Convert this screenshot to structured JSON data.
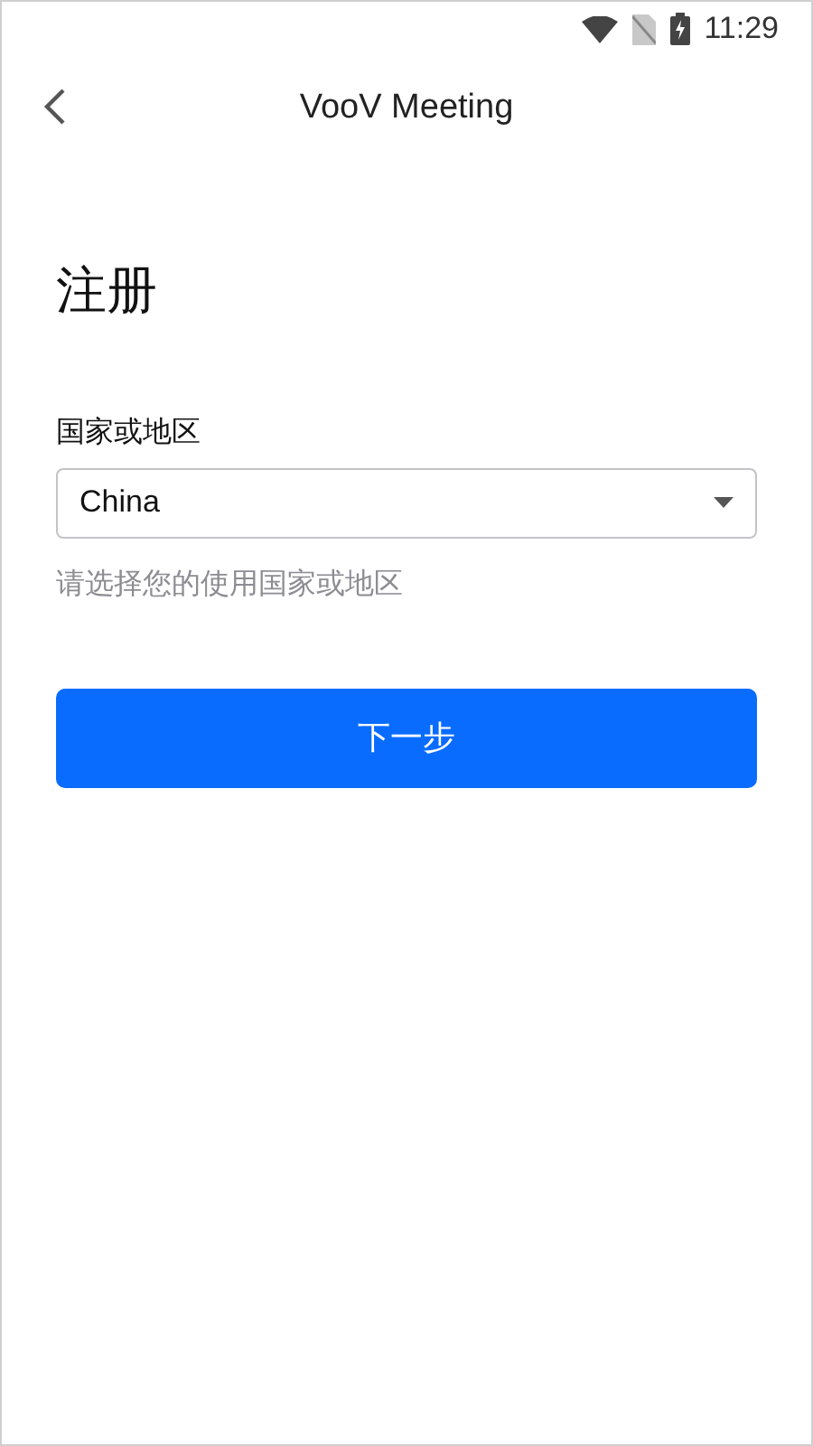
{
  "status_bar": {
    "time": "11:29"
  },
  "header": {
    "title": "VooV Meeting"
  },
  "page_title": "注册",
  "country_field": {
    "label": "国家或地区",
    "value": "China",
    "hint": "请选择您的使用国家或地区"
  },
  "next_button": {
    "label": "下一步"
  }
}
